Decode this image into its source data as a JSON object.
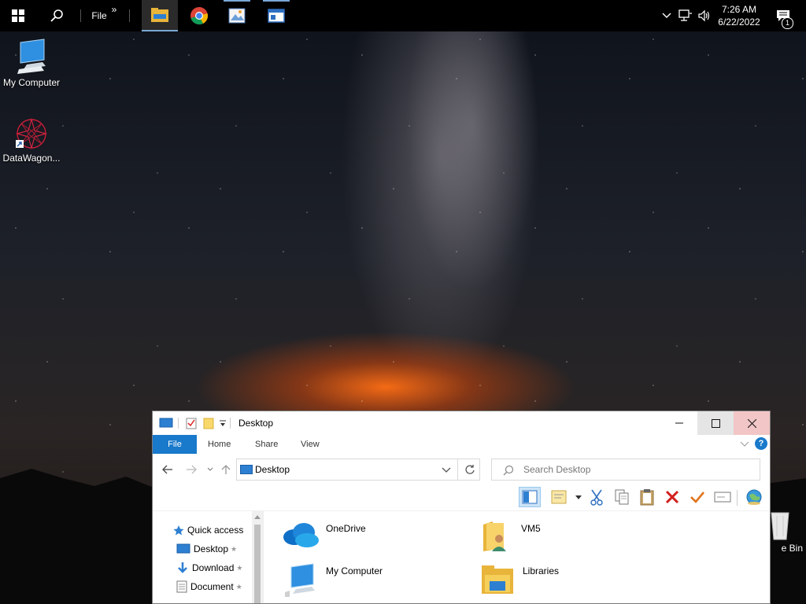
{
  "taskbar": {
    "file_label": "File",
    "overflow_glyph": "»",
    "time": "7:26 AM",
    "date": "6/22/2022",
    "notification_count": "1",
    "apps": [
      "file-explorer",
      "chrome",
      "paint",
      "window-app"
    ]
  },
  "desktop_icons": [
    {
      "label": "My Computer",
      "icon": "computer-icon"
    },
    {
      "label": "DataWagon...",
      "icon": "datawagon-icon"
    },
    {
      "label": "e Bin",
      "icon": "recycle-bin-icon"
    }
  ],
  "explorer": {
    "title": "Desktop",
    "tabs": {
      "file": "File",
      "home": "Home",
      "share": "Share",
      "view": "View"
    },
    "address": "Desktop",
    "search_placeholder": "Search Desktop",
    "nav_pane": [
      "Quick access",
      "Desktop",
      "Download",
      "Document"
    ],
    "items": [
      "OneDrive",
      "VM5",
      "My Computer",
      "Libraries"
    ]
  },
  "colors": {
    "accent": "#1979ca",
    "close_hover": "#f2c6c6",
    "delete_red": "#d21f1f",
    "check_orange": "#e0731c"
  }
}
